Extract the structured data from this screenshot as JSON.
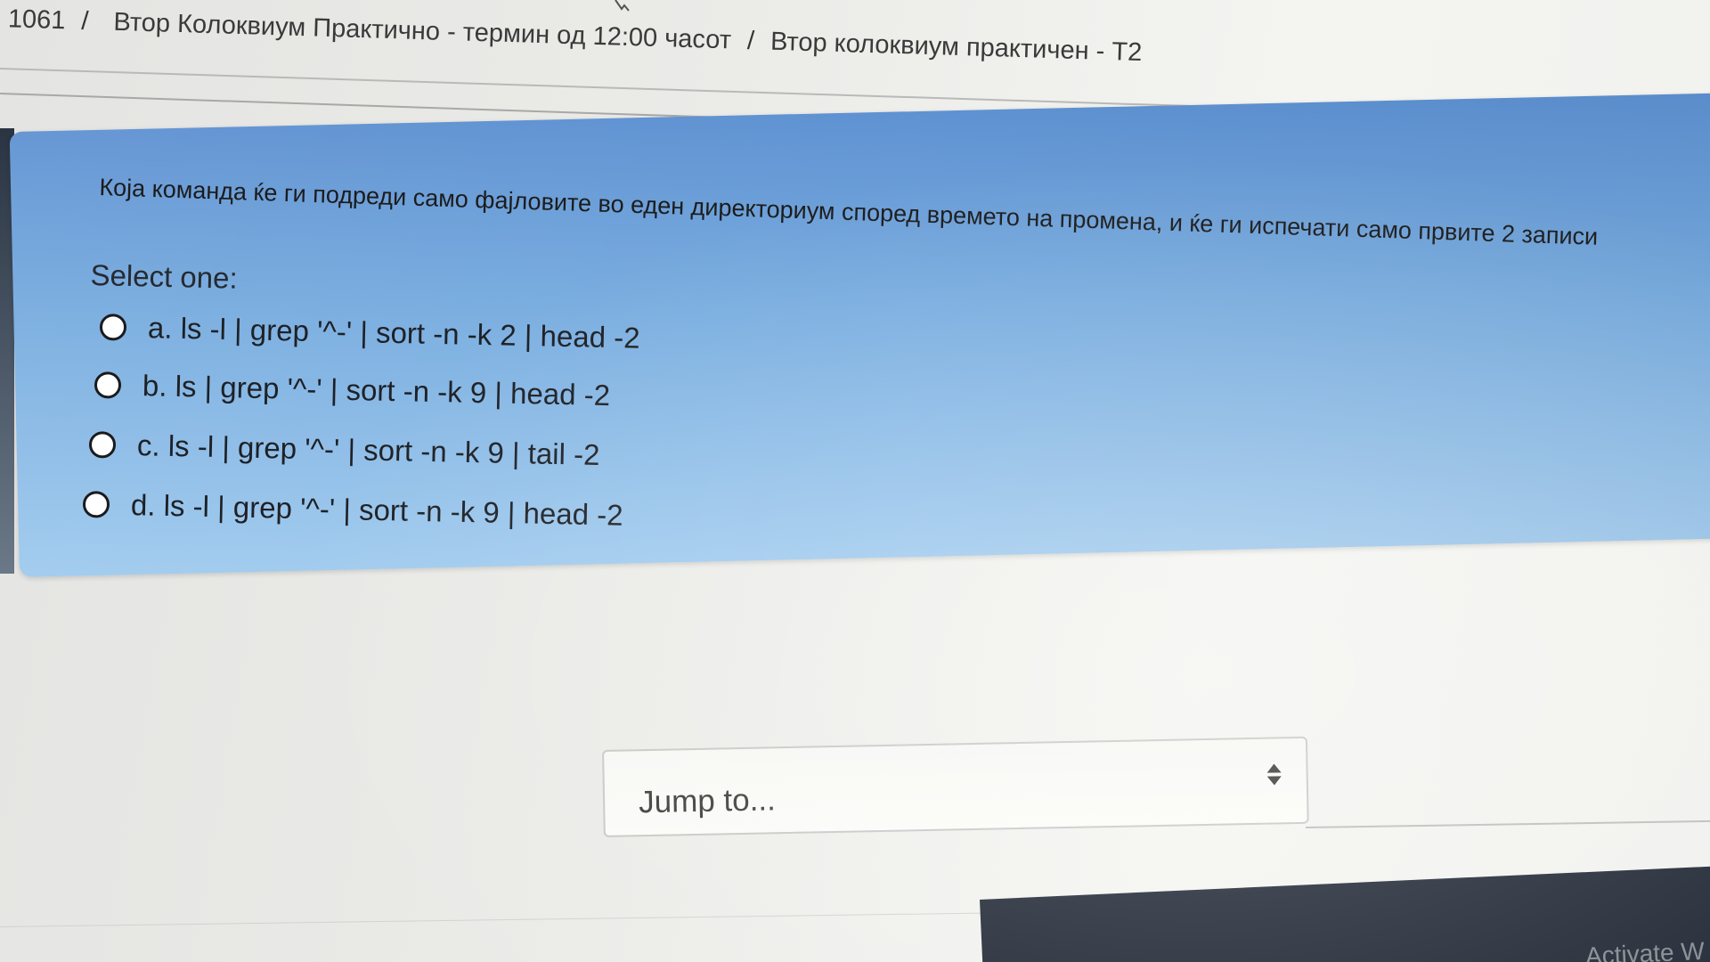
{
  "breadcrumb": {
    "items": [
      {
        "label": "1061"
      },
      {
        "label": "Втор Колоквиум Практично - термин од 12:00 часот"
      },
      {
        "label": "Втор колоквиум практичен - Т2"
      }
    ],
    "separator": "/"
  },
  "question": {
    "text": "Која команда ќе ги подреди само фајловите во еден директориум според времето на промена, и ќе ги испечати само првите 2 записи",
    "prompt": "Select one:",
    "options": [
      {
        "label": "a. ls -l | grep '^-' | sort -n -k 2 | head -2"
      },
      {
        "label": "b. ls | grep '^-' | sort -n -k 9 | head -2"
      },
      {
        "label": "c. ls -l | grep '^-' | sort -n -k 9 | tail -2"
      },
      {
        "label": "d. ls -l | grep '^-' | sort -n -k 9 | head -2"
      }
    ]
  },
  "jump": {
    "label": "Jump to..."
  },
  "taskbar": {
    "watermark": "Activate W"
  },
  "colors": {
    "panel_top": "#5f92d2",
    "panel_bottom": "#9fcaee",
    "text": "#1e2126"
  }
}
